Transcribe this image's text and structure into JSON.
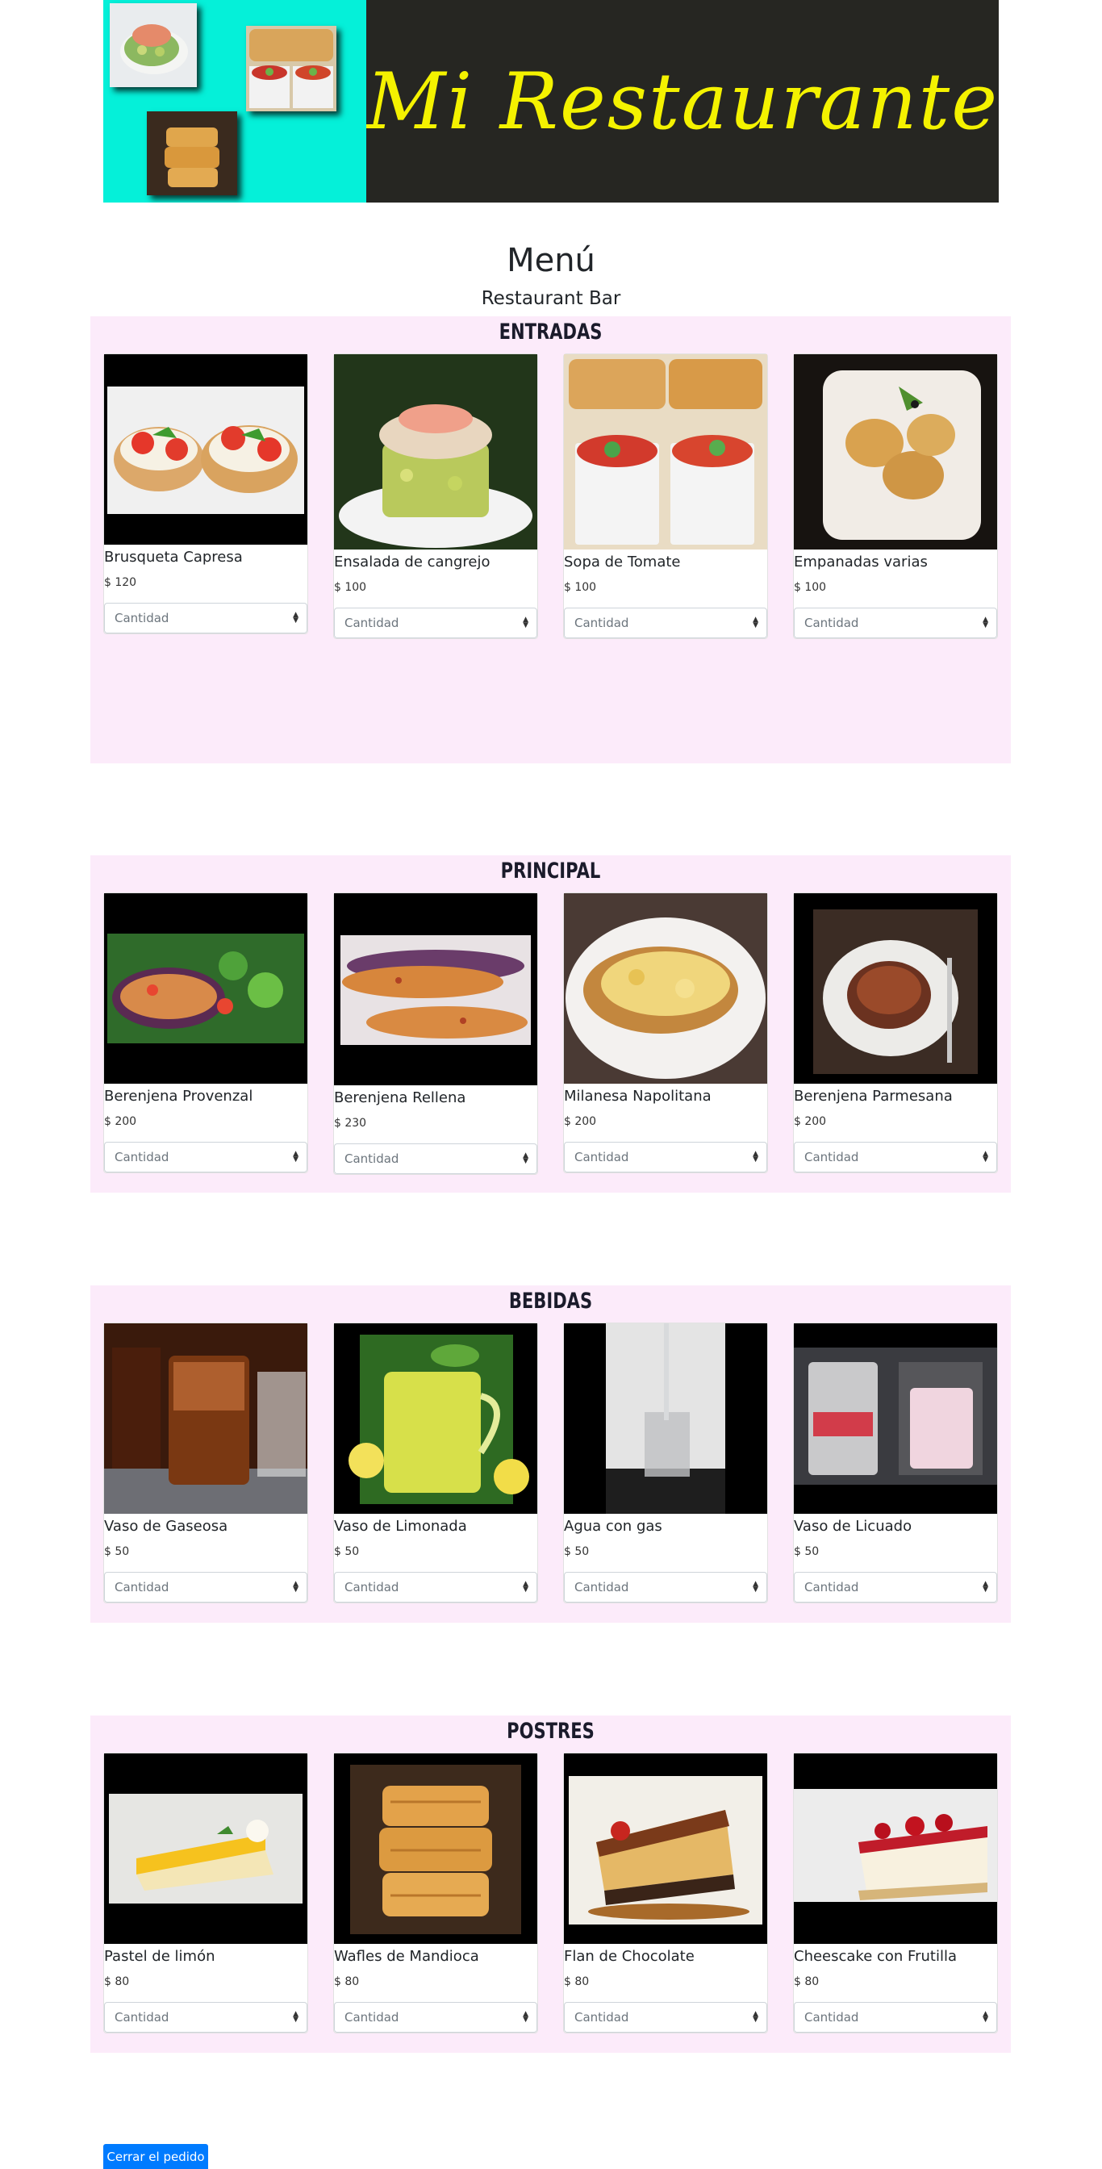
{
  "banner": {
    "title": "Mi Restaurante",
    "colors": {
      "photos_bg": "#05f0d9",
      "title_bg": "#262622",
      "title_text": "#f4f200"
    }
  },
  "page": {
    "title": "Menú",
    "subtitle": "Restaurant Bar"
  },
  "quantity_placeholder": "Cantidad",
  "sections": [
    {
      "title": "ENTRADAS",
      "items": [
        {
          "name": "Brusqueta Capresa",
          "price": "$ 120"
        },
        {
          "name": "Ensalada de cangrejo",
          "price": "$ 100"
        },
        {
          "name": "Sopa de Tomate",
          "price": "$ 100"
        },
        {
          "name": "Empanadas varias",
          "price": "$ 100"
        }
      ]
    },
    {
      "title": "PRINCIPAL",
      "items": [
        {
          "name": "Berenjena Provenzal",
          "price": "$ 200"
        },
        {
          "name": "Berenjena Rellena",
          "price": "$ 230"
        },
        {
          "name": "Milanesa Napolitana",
          "price": "$ 200"
        },
        {
          "name": "Berenjena Parmesana",
          "price": "$ 200"
        }
      ]
    },
    {
      "title": "BEBIDAS",
      "items": [
        {
          "name": "Vaso de Gaseosa",
          "price": "$ 50"
        },
        {
          "name": "Vaso de Limonada",
          "price": "$ 50"
        },
        {
          "name": "Agua con gas",
          "price": "$ 50"
        },
        {
          "name": "Vaso de Licuado",
          "price": "$ 50"
        }
      ]
    },
    {
      "title": "POSTRES",
      "items": [
        {
          "name": "Pastel de limón",
          "price": "$ 80"
        },
        {
          "name": "Wafles de Mandioca",
          "price": "$ 80"
        },
        {
          "name": "Flan de Chocolate",
          "price": "$ 80"
        },
        {
          "name": "Cheescake con Frutilla",
          "price": "$ 80"
        }
      ]
    }
  ],
  "order_button": {
    "label": "Cerrar el pedido"
  },
  "colors": {
    "section_bg": "#fcebfa",
    "button_bg": "#007bff"
  }
}
